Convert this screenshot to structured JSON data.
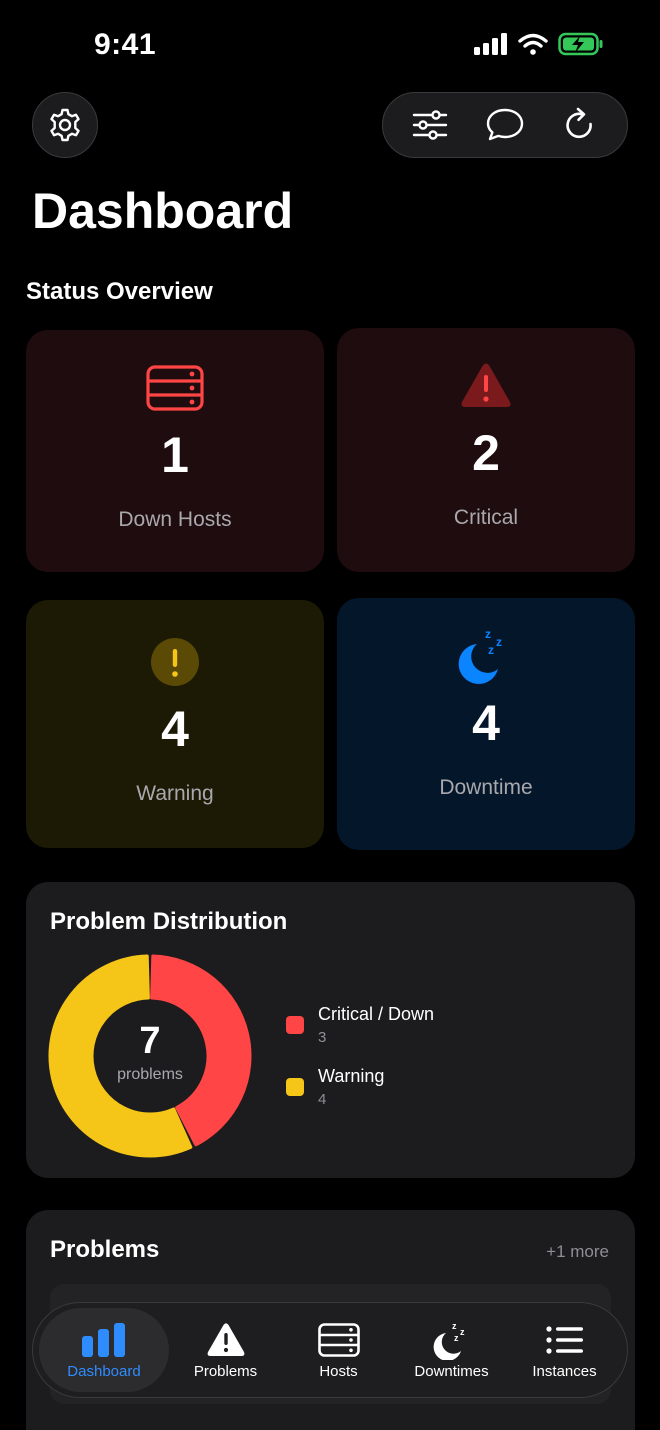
{
  "status_bar": {
    "time": "9:41"
  },
  "header": {
    "title": "Dashboard"
  },
  "overview": {
    "title": "Status Overview",
    "cards": {
      "down_hosts": {
        "count": "1",
        "label": "Down Hosts",
        "icon": "server-icon",
        "color": "#ff4545"
      },
      "critical": {
        "count": "2",
        "label": "Critical",
        "icon": "warning-triangle-icon",
        "color": "#ff4545"
      },
      "warning": {
        "count": "4",
        "label": "Warning",
        "icon": "exclamation-circle-icon",
        "color": "#f5c518"
      },
      "downtime": {
        "count": "4",
        "label": "Downtime",
        "icon": "moon-zzz-icon",
        "color": "#2f8cff"
      }
    }
  },
  "distribution": {
    "title": "Problem Distribution",
    "total": "7",
    "caption": "problems",
    "items": [
      {
        "name": "Critical / Down",
        "value": "3",
        "color": "#ff4545"
      },
      {
        "name": "Warning",
        "value": "4",
        "color": "#f5c518"
      }
    ]
  },
  "problems": {
    "title": "Problems",
    "more": "+1 more"
  },
  "tabs": [
    {
      "label": "Dashboard",
      "icon": "bar-chart-icon"
    },
    {
      "label": "Problems",
      "icon": "warning-triangle-icon"
    },
    {
      "label": "Hosts",
      "icon": "server-icon"
    },
    {
      "label": "Downtimes",
      "icon": "moon-zzz-icon"
    },
    {
      "label": "Instances",
      "icon": "list-icon"
    }
  ]
}
